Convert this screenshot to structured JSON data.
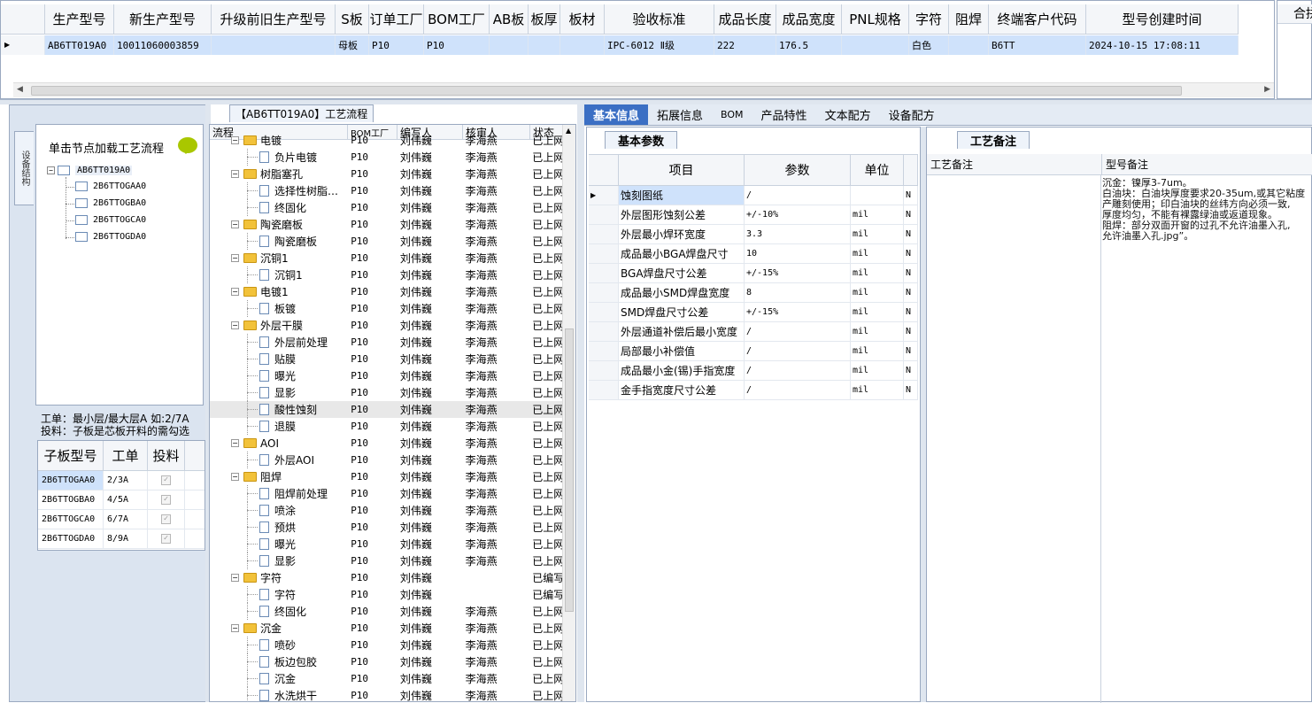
{
  "top_grid": {
    "headers": [
      "生产型号",
      "新生产型号",
      "升级前旧生产型号",
      "S板",
      "订单工厂",
      "BOM工厂",
      "AB板",
      "板厚",
      "板材",
      "验收标准",
      "成品长度",
      "成品宽度",
      "PNL规格",
      "字符",
      "阻焊",
      "终端客户代码",
      "型号创建时间"
    ],
    "row": [
      "AB6TT019A0",
      "10011060003859",
      "",
      "母板",
      "P10",
      "P10",
      "",
      "",
      "",
      "IPC-6012 Ⅱ级",
      "222",
      "176.5",
      "",
      "白色",
      "",
      "B6TT",
      "2024-10-15 17:08:11"
    ],
    "right_stub_header": "合拼"
  },
  "left": {
    "vertical_tab": "设备结构",
    "hint": "单击节点加载工艺流程",
    "tree_root": "AB6TT019A0",
    "tree_children": [
      "2B6TTOGAA0",
      "2B6TTOGBA0",
      "2B6TTOGCA0",
      "2B6TTOGDA0"
    ],
    "note_line1": "工单：最小层/最大层A 如:2/7A",
    "note_line2": "投料：子板是芯板开料的需勾选",
    "sub_headers": [
      "子板型号",
      "工单",
      "投料"
    ],
    "sub_rows": [
      {
        "model": "2B6TTOGAA0",
        "order": "2/3A"
      },
      {
        "model": "2B6TTOGBA0",
        "order": "4/5A"
      },
      {
        "model": "2B6TTOGCA0",
        "order": "6/7A"
      },
      {
        "model": "2B6TTOGDA0",
        "order": "8/9A"
      }
    ]
  },
  "process": {
    "title": "【AB6TT019A0】工艺流程",
    "headers": [
      "流程",
      "BOM工厂",
      "编写人",
      "核审人",
      "状态"
    ],
    "rows": [
      {
        "level": 0,
        "name": "电镀",
        "factory": "P10",
        "writer": "刘伟巍",
        "reviewer": "李海燕",
        "status": "已上网"
      },
      {
        "level": 1,
        "name": "负片电镀",
        "factory": "P10",
        "writer": "刘伟巍",
        "reviewer": "李海燕",
        "status": "已上网"
      },
      {
        "level": 0,
        "name": "树脂塞孔",
        "factory": "P10",
        "writer": "刘伟巍",
        "reviewer": "李海燕",
        "status": "已上网"
      },
      {
        "level": 1,
        "name": "选择性树脂…",
        "factory": "P10",
        "writer": "刘伟巍",
        "reviewer": "李海燕",
        "status": "已上网"
      },
      {
        "level": 1,
        "name": "终固化",
        "factory": "P10",
        "writer": "刘伟巍",
        "reviewer": "李海燕",
        "status": "已上网"
      },
      {
        "level": 0,
        "name": "陶瓷磨板",
        "factory": "P10",
        "writer": "刘伟巍",
        "reviewer": "李海燕",
        "status": "已上网"
      },
      {
        "level": 1,
        "name": "陶瓷磨板",
        "factory": "P10",
        "writer": "刘伟巍",
        "reviewer": "李海燕",
        "status": "已上网"
      },
      {
        "level": 0,
        "name": "沉铜1",
        "factory": "P10",
        "writer": "刘伟巍",
        "reviewer": "李海燕",
        "status": "已上网"
      },
      {
        "level": 1,
        "name": "沉铜1",
        "factory": "P10",
        "writer": "刘伟巍",
        "reviewer": "李海燕",
        "status": "已上网"
      },
      {
        "level": 0,
        "name": "电镀1",
        "factory": "P10",
        "writer": "刘伟巍",
        "reviewer": "李海燕",
        "status": "已上网"
      },
      {
        "level": 1,
        "name": "板镀",
        "factory": "P10",
        "writer": "刘伟巍",
        "reviewer": "李海燕",
        "status": "已上网"
      },
      {
        "level": 0,
        "name": "外层干膜",
        "factory": "P10",
        "writer": "刘伟巍",
        "reviewer": "李海燕",
        "status": "已上网"
      },
      {
        "level": 1,
        "name": "外层前处理",
        "factory": "P10",
        "writer": "刘伟巍",
        "reviewer": "李海燕",
        "status": "已上网"
      },
      {
        "level": 1,
        "name": "贴膜",
        "factory": "P10",
        "writer": "刘伟巍",
        "reviewer": "李海燕",
        "status": "已上网"
      },
      {
        "level": 1,
        "name": "曝光",
        "factory": "P10",
        "writer": "刘伟巍",
        "reviewer": "李海燕",
        "status": "已上网"
      },
      {
        "level": 1,
        "name": "显影",
        "factory": "P10",
        "writer": "刘伟巍",
        "reviewer": "李海燕",
        "status": "已上网"
      },
      {
        "level": 1,
        "name": "酸性蚀刻",
        "factory": "P10",
        "writer": "刘伟巍",
        "reviewer": "李海燕",
        "status": "已上网",
        "selected": true
      },
      {
        "level": 1,
        "name": "退膜",
        "factory": "P10",
        "writer": "刘伟巍",
        "reviewer": "李海燕",
        "status": "已上网"
      },
      {
        "level": 0,
        "name": "AOI",
        "factory": "P10",
        "writer": "刘伟巍",
        "reviewer": "李海燕",
        "status": "已上网"
      },
      {
        "level": 1,
        "name": "外层AOI",
        "factory": "P10",
        "writer": "刘伟巍",
        "reviewer": "李海燕",
        "status": "已上网"
      },
      {
        "level": 0,
        "name": "阻焊",
        "factory": "P10",
        "writer": "刘伟巍",
        "reviewer": "李海燕",
        "status": "已上网"
      },
      {
        "level": 1,
        "name": "阻焊前处理",
        "factory": "P10",
        "writer": "刘伟巍",
        "reviewer": "李海燕",
        "status": "已上网"
      },
      {
        "level": 1,
        "name": "喷涂",
        "factory": "P10",
        "writer": "刘伟巍",
        "reviewer": "李海燕",
        "status": "已上网"
      },
      {
        "level": 1,
        "name": "预烘",
        "factory": "P10",
        "writer": "刘伟巍",
        "reviewer": "李海燕",
        "status": "已上网"
      },
      {
        "level": 1,
        "name": "曝光",
        "factory": "P10",
        "writer": "刘伟巍",
        "reviewer": "李海燕",
        "status": "已上网"
      },
      {
        "level": 1,
        "name": "显影",
        "factory": "P10",
        "writer": "刘伟巍",
        "reviewer": "李海燕",
        "status": "已上网"
      },
      {
        "level": 0,
        "name": "字符",
        "factory": "P10",
        "writer": "刘伟巍",
        "reviewer": "",
        "status": "已编写"
      },
      {
        "level": 1,
        "name": "字符",
        "factory": "P10",
        "writer": "刘伟巍",
        "reviewer": "",
        "status": "已编写"
      },
      {
        "level": 1,
        "name": "终固化",
        "factory": "P10",
        "writer": "刘伟巍",
        "reviewer": "李海燕",
        "status": "已上网"
      },
      {
        "level": 0,
        "name": "沉金",
        "factory": "P10",
        "writer": "刘伟巍",
        "reviewer": "李海燕",
        "status": "已上网"
      },
      {
        "level": 1,
        "name": "喷砂",
        "factory": "P10",
        "writer": "刘伟巍",
        "reviewer": "李海燕",
        "status": "已上网"
      },
      {
        "level": 1,
        "name": "板边包胶",
        "factory": "P10",
        "writer": "刘伟巍",
        "reviewer": "李海燕",
        "status": "已上网"
      },
      {
        "level": 1,
        "name": "沉金",
        "factory": "P10",
        "writer": "刘伟巍",
        "reviewer": "李海燕",
        "status": "已上网"
      },
      {
        "level": 1,
        "name": "水洗烘干",
        "factory": "P10",
        "writer": "刘伟巍",
        "reviewer": "李海燕",
        "status": "已上网"
      }
    ]
  },
  "tabs": [
    "基本信息",
    "拓展信息",
    "BOM",
    "产品特性",
    "文本配方",
    "设备配方"
  ],
  "basic": {
    "subtab": "基本参数",
    "headers": [
      "项目",
      "参数",
      "单位"
    ],
    "rows": [
      {
        "item": "蚀刻图纸",
        "param": "/",
        "unit": "",
        "flag": "N"
      },
      {
        "item": "外层图形蚀刻公差",
        "param": "+/-10%",
        "unit": "mil",
        "flag": "N"
      },
      {
        "item": "外层最小焊环宽度",
        "param": "3.3",
        "unit": "mil",
        "flag": "N"
      },
      {
        "item": "成品最小BGA焊盘尺寸",
        "param": "10",
        "unit": "mil",
        "flag": "N"
      },
      {
        "item": "BGA焊盘尺寸公差",
        "param": "+/-15%",
        "unit": "mil",
        "flag": "N"
      },
      {
        "item": "成品最小SMD焊盘宽度",
        "param": "8",
        "unit": "mil",
        "flag": "N"
      },
      {
        "item": "SMD焊盘尺寸公差",
        "param": "+/-15%",
        "unit": "mil",
        "flag": "N"
      },
      {
        "item": "外层通道补偿后最小宽度",
        "param": "/",
        "unit": "mil",
        "flag": "N"
      },
      {
        "item": "局部最小补偿值",
        "param": "/",
        "unit": "mil",
        "flag": "N"
      },
      {
        "item": "成品最小金(锡)手指宽度",
        "param": "/",
        "unit": "mil",
        "flag": "N"
      },
      {
        "item": "金手指宽度尺寸公差",
        "param": "/",
        "unit": "mil",
        "flag": "N"
      }
    ]
  },
  "remark": {
    "subtab": "工艺备注",
    "col1": "工艺备注",
    "col2": "型号备注",
    "text": "沉金：镍厚3-7um。\n白油块：白油块厚度要求20-35um,或其它粘度\n产雕刻使用；印白油块的丝纬方向必须一致,\n厚度均匀，不能有裸露绿油或返道现象。\n阻焊：部分双面开窗的过孔不允许油墨入孔,\n允许油墨入孔.jpg”。"
  }
}
